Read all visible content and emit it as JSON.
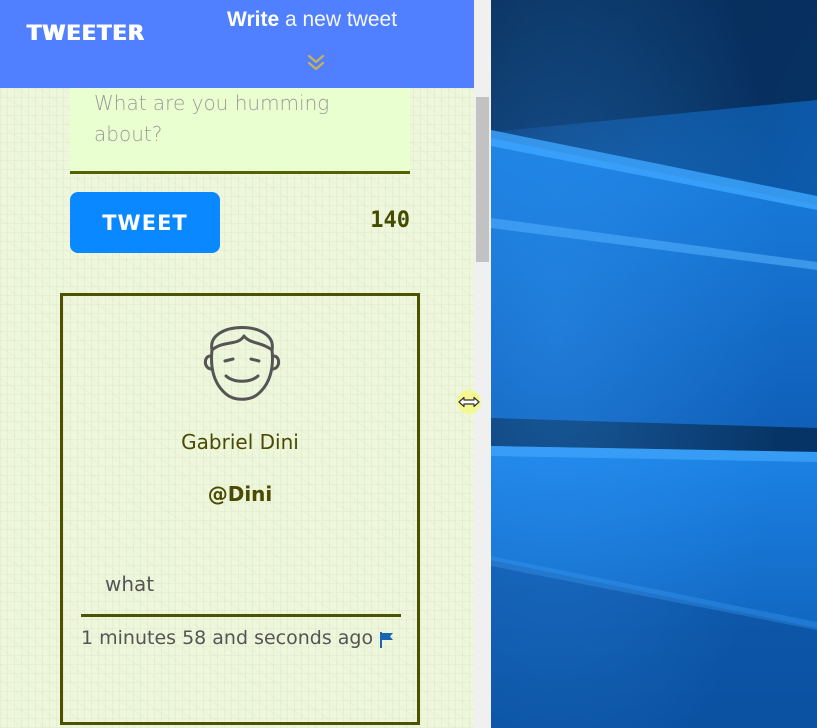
{
  "header": {
    "brand": "TWEETER",
    "compose_strong": "Write",
    "compose_rest": " a new tweet"
  },
  "compose": {
    "placeholder": "What are you humming about?",
    "button_label": "TWEET",
    "char_count": "140"
  },
  "tweet": {
    "author_name": "Gabriel Dini",
    "author_handle": "@Dini",
    "text": "what",
    "timestamp": "1 minutes 58 and seconds ago"
  },
  "icons": {
    "chevron": "double-chevron-down-icon",
    "avatar": "smiling-face-icon",
    "flag": "flag-icon",
    "cursor": "resize-horizontal-icon"
  },
  "colors": {
    "header_bg": "#5080ff",
    "button_bg": "#0a88ff",
    "input_bg": "#eaffcf",
    "border_olive": "#4c5200",
    "count_olive": "#434b00",
    "flag_blue": "#1b63b3"
  }
}
